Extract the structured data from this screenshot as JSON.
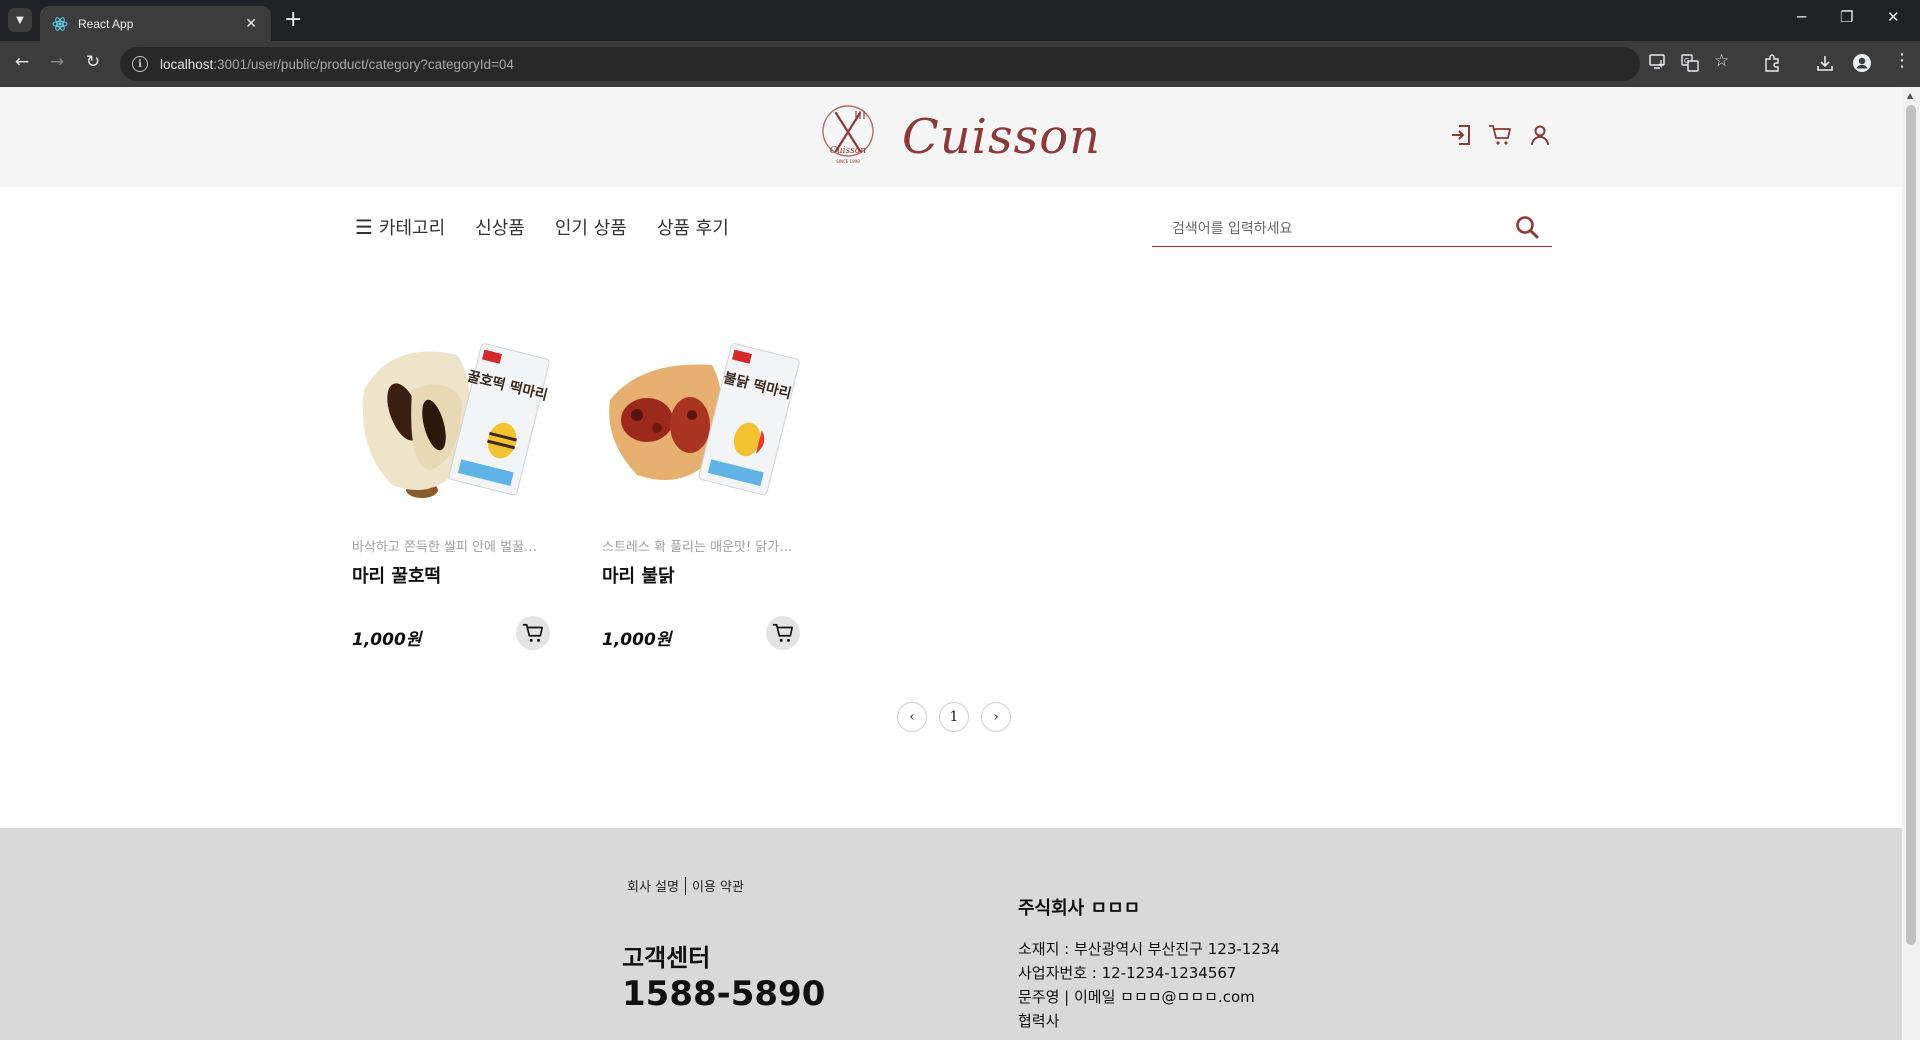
{
  "browser": {
    "tab_title": "React App",
    "url_host": "localhost",
    "url_rest": ":3001/user/public/product/category?categoryId=04"
  },
  "header": {
    "logo_text": "Cuisson",
    "logo_emblem_text": "Cuisson",
    "logo_emblem_subtext": "SINCE 1998",
    "icons": [
      "login-icon",
      "cart-icon",
      "user-icon"
    ]
  },
  "nav": {
    "items": [
      {
        "label": "카테고리",
        "icon": "hamburger-icon"
      },
      {
        "label": "신상품"
      },
      {
        "label": "인기 상품"
      },
      {
        "label": "상품 후기"
      }
    ]
  },
  "search": {
    "placeholder": "검색어를 입력하세요",
    "value": ""
  },
  "products": [
    {
      "desc": "바삭하고 쫀득한 쌀피 안에 벌꿀…",
      "name": "마리 꿀호떡",
      "price": "1,000원",
      "package_label": "꿀호떡 떡마리"
    },
    {
      "desc": "스트레스 확 풀리는 매운맛! 닭가…",
      "name": "마리 불닭",
      "price": "1,000원",
      "package_label": "불닭 떡마리"
    }
  ],
  "pagination": {
    "prev": "‹",
    "current": "1",
    "next": "›"
  },
  "footer": {
    "links": [
      "회사 설명",
      "이용 약관"
    ],
    "cs_title": "고객센터",
    "cs_phone": "1588-5890",
    "company": "주식회사 ㅁㅁㅁ",
    "address": "소재지 : 부산광역시 부산진구 123-1234",
    "biz_no": "사업자번호 : 12-1234-1234567",
    "contact": "문주영 | 이메일 ㅁㅁㅁ@ㅁㅁㅁ.com",
    "partner": "협력사"
  },
  "colors": {
    "brand": "#8b3a3a",
    "header_bg": "#f5f5f5",
    "footer_bg": "#d9d9d9",
    "chrome_dark": "#202124",
    "chrome_toolbar": "#3c3c3c"
  }
}
